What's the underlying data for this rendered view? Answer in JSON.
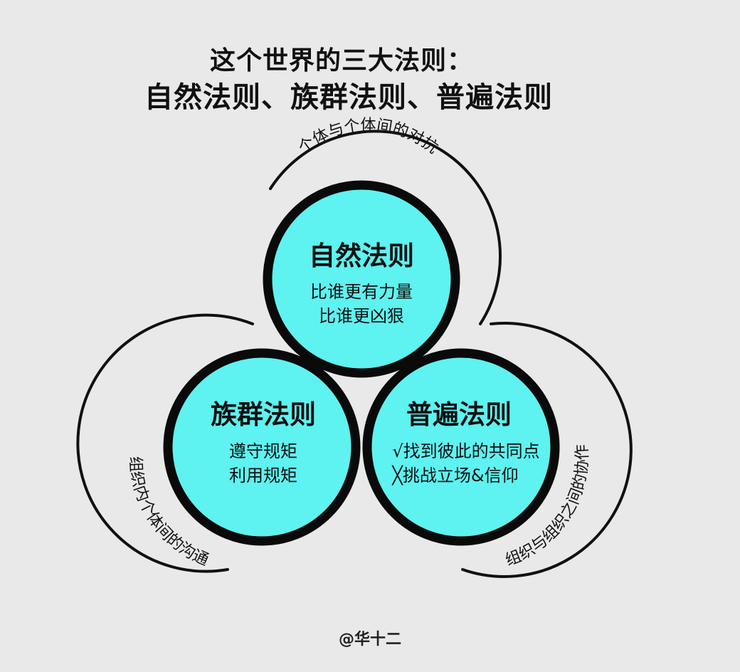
{
  "title": {
    "line1": "这个世界的三大法则：",
    "line2": "自然法则、族群法则、普遍法则"
  },
  "circles": {
    "top": {
      "title": "自然法则",
      "lines": [
        "比谁更有力量",
        "比谁更凶狠"
      ]
    },
    "left": {
      "title": "族群法则",
      "lines": [
        "遵守规矩",
        "利用规矩"
      ]
    },
    "right": {
      "title": "普遍法则",
      "lines": [
        "√找到彼此的共同点",
        "╳挑战立场&信仰"
      ]
    }
  },
  "arc_labels": {
    "top": "个体与个体间的对抗",
    "left": "组织内个体间的沟通",
    "right": "组织与组织之间的协作"
  },
  "credit": "@华十二",
  "colors": {
    "background": "#e9e9ea",
    "circle_fill": "#5ef2f0",
    "circle_stroke": "#0a0a0a"
  }
}
